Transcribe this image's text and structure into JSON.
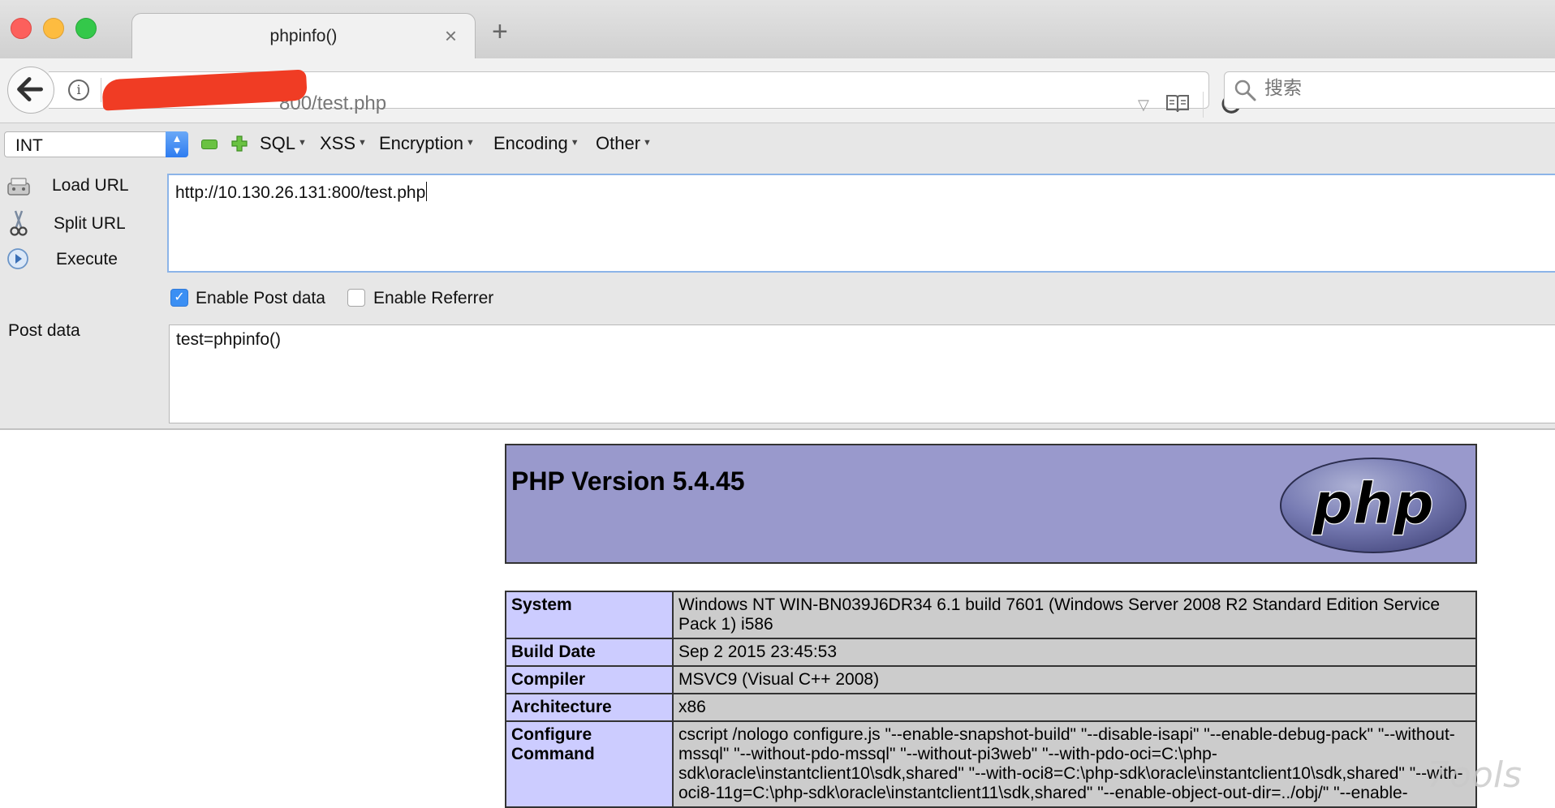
{
  "tab": {
    "title": "phpinfo()",
    "close": "×",
    "new_tab": "+"
  },
  "navbar": {
    "url_visible": "800/test.php",
    "search_placeholder": "搜索",
    "info_glyph": "i"
  },
  "hackbar": {
    "select_value": "INT",
    "menus": [
      "SQL",
      "XSS",
      "Encryption",
      "Encoding",
      "Other"
    ],
    "buttons": {
      "load": "Load URL",
      "split": "Split URL",
      "execute": "Execute"
    },
    "url_value": "http://10.130.26.131:800/test.php",
    "enable_post_label": "Enable Post data",
    "enable_post_checked": true,
    "enable_referrer_label": "Enable Referrer",
    "enable_referrer_checked": false,
    "post_label": "Post data",
    "post_value": "test=phpinfo()"
  },
  "phpinfo": {
    "version": "PHP Version 5.4.45",
    "logo_text": "php",
    "rows": [
      {
        "key": "System",
        "value": "Windows NT WIN-BN039J6DR34 6.1 build 7601 (Windows Server 2008 R2 Standard Edition Service Pack 1) i586"
      },
      {
        "key": "Build Date",
        "value": "Sep 2 2015 23:45:53"
      },
      {
        "key": "Compiler",
        "value": "MSVC9 (Visual C++ 2008)"
      },
      {
        "key": "Architecture",
        "value": "x86"
      },
      {
        "key": "Configure Command",
        "value": "cscript /nologo configure.js \"--enable-snapshot-build\" \"--disable-isapi\" \"--enable-debug-pack\" \"--without-mssql\" \"--without-pdo-mssql\" \"--without-pi3web\" \"--with-pdo-oci=C:\\php-sdk\\oracle\\instantclient10\\sdk,shared\" \"--with-oci8=C:\\php-sdk\\oracle\\instantclient10\\sdk,shared\" \"--with-oci8-11g=C:\\php-sdk\\oracle\\instantclient11\\sdk,shared\" \"--enable-object-out-dir=../obj/\" \"--enable-"
      }
    ]
  },
  "watermark": "7ools"
}
